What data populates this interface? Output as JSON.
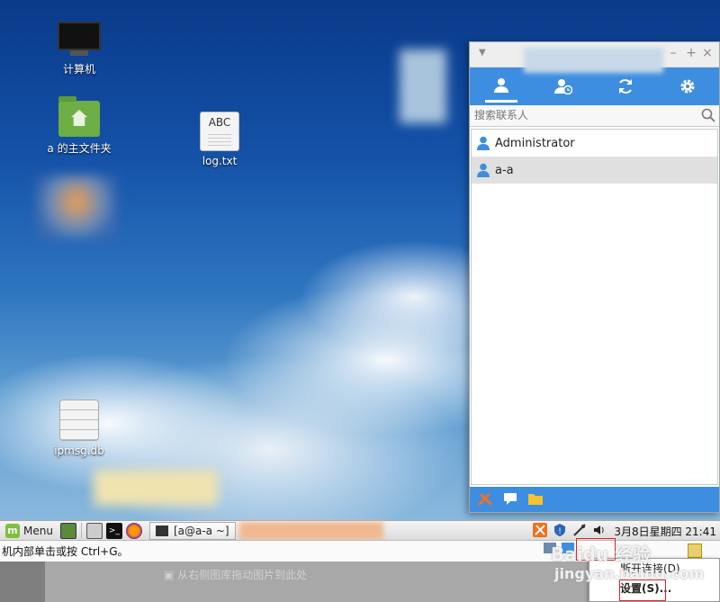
{
  "desktop": {
    "icons": [
      {
        "label": "计算机",
        "icon": "computer-icon"
      },
      {
        "label": "a 的主文件夹",
        "icon": "home-folder-icon"
      },
      {
        "label": "log.txt",
        "icon": "text-file-icon",
        "glyph_text": "ABC"
      },
      {
        "label": "ipmsg.db",
        "icon": "database-file-icon"
      }
    ]
  },
  "im_window": {
    "search": {
      "placeholder": "搜索联系人"
    },
    "contacts": [
      {
        "name": "Administrator",
        "selected": false
      },
      {
        "name": "a-a",
        "selected": true
      }
    ],
    "accent": "#3d8ee0"
  },
  "taskbar": {
    "menu_label": "Menu",
    "terminal_task": "[a@a-a ~]",
    "clock": "3月8日星期四 21:41"
  },
  "hint_bar": {
    "text": "机内部单击或按 Ctrl+G。"
  },
  "bottom_area": {
    "drop_hint": "从右侧图库拖动图片到此处"
  },
  "context_menu": {
    "items": [
      {
        "label": "断开连接(D)"
      },
      {
        "label": "设置(S)..."
      }
    ]
  },
  "watermark": {
    "line1": "Baidu 经验",
    "line2": "jingyan.baidu.com"
  }
}
